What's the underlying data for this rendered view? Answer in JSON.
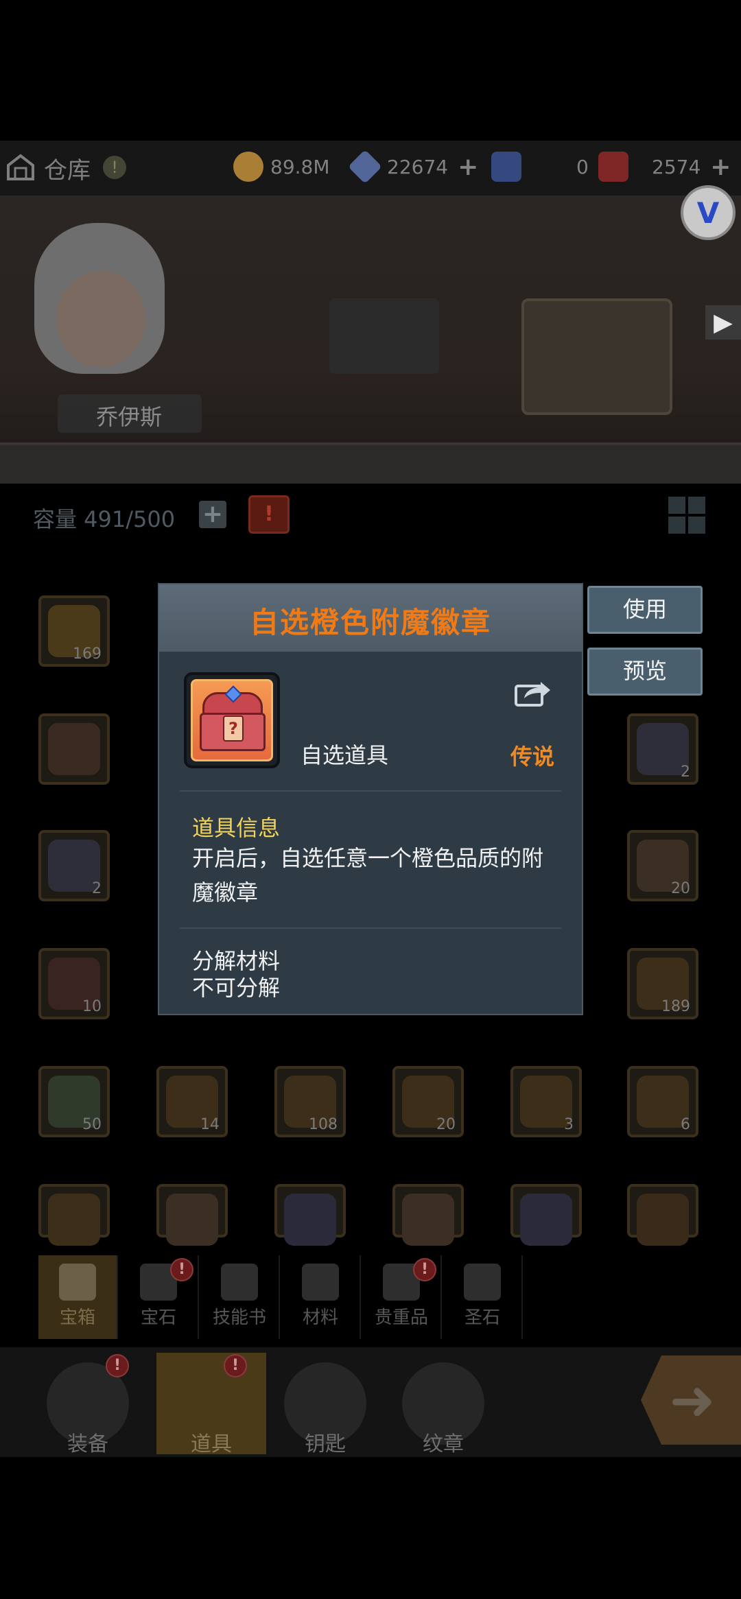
{
  "topbar": {
    "title": "仓库",
    "alert": "!",
    "resources": [
      {
        "name": "gold",
        "value": "89.8M",
        "color": "#b88a3b",
        "plus": ""
      },
      {
        "name": "crystal",
        "value": "22674",
        "color": "#5a6fa8",
        "plus": "+"
      },
      {
        "name": "ticket-blue",
        "value": "0",
        "color": "#3a4f8a",
        "plus": ""
      },
      {
        "name": "ticket-red",
        "value": "2574",
        "color": "#8a2a2a",
        "plus": "+"
      }
    ]
  },
  "scene": {
    "hero_name": "乔伊斯",
    "badge": "V"
  },
  "capacity": {
    "label": "容量 491/500"
  },
  "grid": {
    "counts": [
      "169",
      "2",
      "2",
      "20",
      "10",
      "189",
      "50",
      "14",
      "108",
      "20",
      "3",
      "6"
    ]
  },
  "modal": {
    "title": "自选橙色附魔徽章",
    "item_type": "自选道具",
    "rarity": "传说",
    "info_title": "道具信息",
    "info_text": "开启后，自选任意一个橙色品质的附魔徽章",
    "material_title": "分解材料",
    "material_text": "不可分解",
    "use_label": "使用",
    "preview_label": "预览"
  },
  "categories": [
    {
      "label": "宝箱",
      "active": true
    },
    {
      "label": "宝石",
      "badge": "!"
    },
    {
      "label": "技能书"
    },
    {
      "label": "材料"
    },
    {
      "label": "贵重品",
      "badge": "!"
    },
    {
      "label": "圣石"
    }
  ],
  "nav": [
    {
      "label": "装备",
      "badge": "!"
    },
    {
      "label": "道具",
      "badge": "!",
      "active": true
    },
    {
      "label": "钥匙"
    },
    {
      "label": "纹章"
    }
  ]
}
